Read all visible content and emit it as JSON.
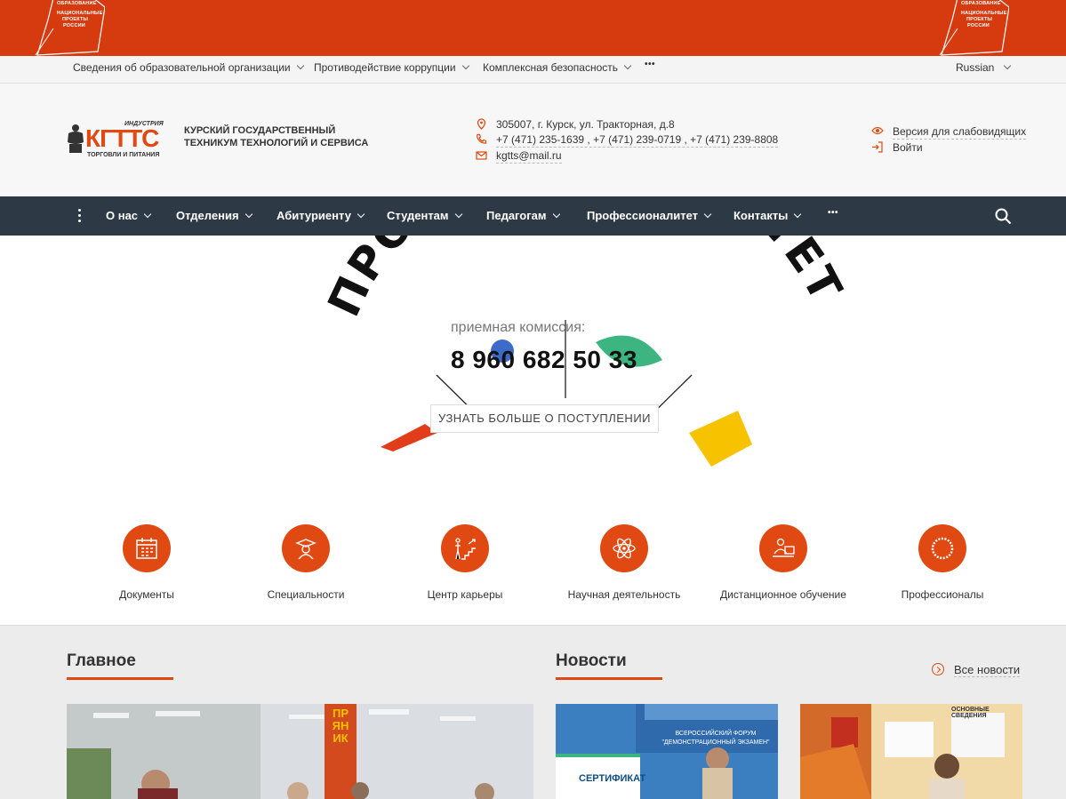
{
  "banner": {
    "logo_line1": "ОБРАЗОВАНИЕ",
    "logo_line2": "НАЦИОНАЛЬНЫЕ",
    "logo_line3": "ПРОЕКТЫ",
    "logo_line4": "РОССИИ",
    "color": "#d63b10"
  },
  "topbar": {
    "items": [
      {
        "label": "Сведения об образовательной организации"
      },
      {
        "label": "Противодействие коррупции"
      },
      {
        "label": "Комплексная безопасность"
      }
    ],
    "more": "•••",
    "language": "Russian"
  },
  "header": {
    "logo_top": "ИНДУСТРИЯ",
    "logo_main": "КГТТС",
    "logo_bottom": "ТОРГОВЛИ И ПИТАНИЯ",
    "school_name": "Курский государственный техникум технологий и сервиса",
    "address": "305007, г. Курск, ул. Тракторная, д.8",
    "phones": "+7 (471) 235-1639 , +7 (471) 239-0719 , +7 (471) 239-8808",
    "email": "kgtts@mail.ru",
    "accessibility": "Версия для слабовидящих",
    "login": "Войти"
  },
  "nav": {
    "items": [
      {
        "label": "О нас"
      },
      {
        "label": "Отделения"
      },
      {
        "label": "Абитуриенту"
      },
      {
        "label": "Студентам"
      },
      {
        "label": "Педагогам"
      },
      {
        "label": "Профессионалитет"
      },
      {
        "label": "Контакты"
      }
    ],
    "more": "•••",
    "bg_color": "#2d3a45"
  },
  "hero": {
    "arc_text": "ПРОФЕССИОНАЛИТЕТ",
    "admission_label": "приемная комиссия:",
    "admission_phone": "8 960 682 50 33",
    "learn_more": "УЗНАТЬ БОЛЬШЕ О ПОСТУПЛЕНИИ"
  },
  "quick_links": [
    {
      "label": "Документы",
      "icon": "calendar-icon"
    },
    {
      "label": "Специальности",
      "icon": "graduate-icon"
    },
    {
      "label": "Центр карьеры",
      "icon": "career-stairs-icon"
    },
    {
      "label": "Научная деятельность",
      "icon": "atom-icon"
    },
    {
      "label": "Дистанционное обучение",
      "icon": "distance-learning-icon"
    },
    {
      "label": "Профессионалы",
      "icon": "professionals-icon"
    }
  ],
  "main_section": {
    "title": "Главное"
  },
  "news_section": {
    "title": "Новости",
    "all_news": "Все новости"
  },
  "news_photo1": {
    "banner": "ВСЕРОССИЙСКИЙ ФОРУМ",
    "subbanner": "\"ДЕМОНСТРАЦИОННЫЙ ЭКЗАМЕН\"",
    "certificate": "СЕРТИФИКАТ"
  },
  "news_photo2": {
    "board": "ОСНОВНЫЕ СВЕДЕНИЯ"
  },
  "main_photo": {
    "sign": "ПРЯНИК"
  },
  "accent_color": "#e04a12"
}
